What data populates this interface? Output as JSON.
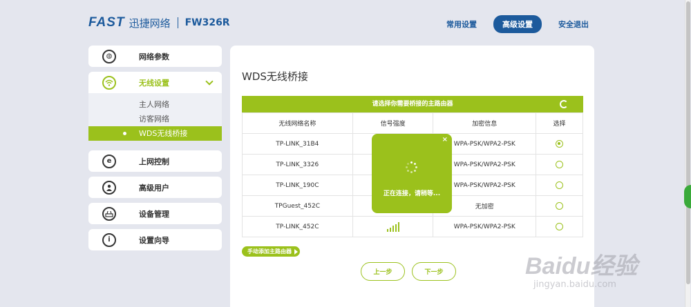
{
  "header": {
    "brand": "FAST",
    "brand_cn": "迅捷网络",
    "model": "FW326R",
    "nav": {
      "common": "常用设置",
      "advanced": "高级设置",
      "logout": "安全退出"
    }
  },
  "sidebar": {
    "items": [
      {
        "label": "网络参数",
        "icon": "globe-icon"
      },
      {
        "label": "无线设置",
        "icon": "wifi-icon"
      },
      {
        "label": "上网控制",
        "icon": "ie-icon"
      },
      {
        "label": "高级用户",
        "icon": "user-icon"
      },
      {
        "label": "设备管理",
        "icon": "router-icon"
      },
      {
        "label": "设置向导",
        "icon": "info-icon"
      }
    ],
    "wireless_sub": [
      "主人网络",
      "访客网络",
      "WDS无线桥接"
    ]
  },
  "main": {
    "title": "WDS无线桥接",
    "table_banner": "请选择你需要桥接的主路由器",
    "columns": [
      "无线网络名称",
      "信号强度",
      "加密信息",
      "选择"
    ],
    "rows": [
      {
        "ssid": "TP-LINK_31B4",
        "enc": "WPA-PSK/WPA2-PSK",
        "selected": true
      },
      {
        "ssid": "TP-LINK_3326",
        "enc": "WPA-PSK/WPA2-PSK",
        "selected": false
      },
      {
        "ssid": "TP-LINK_190C",
        "enc": "WPA-PSK/WPA2-PSK",
        "selected": false
      },
      {
        "ssid": "TPGuest_452C",
        "enc": "无加密",
        "selected": false
      },
      {
        "ssid": "TP-LINK_452C",
        "enc": "WPA-PSK/WPA2-PSK",
        "selected": false
      }
    ],
    "manual_add": "手动添加主路由器",
    "prev": "上一步",
    "next": "下一步"
  },
  "modal": {
    "close": "×",
    "message": "正在连接，请稍等..."
  },
  "watermark": {
    "main": "Baidu经验",
    "sub": "jingyan.baidu.com"
  },
  "colors": {
    "accent": "#9bc11c",
    "brand": "#1c5a9c",
    "background": "#e4e6ee"
  }
}
